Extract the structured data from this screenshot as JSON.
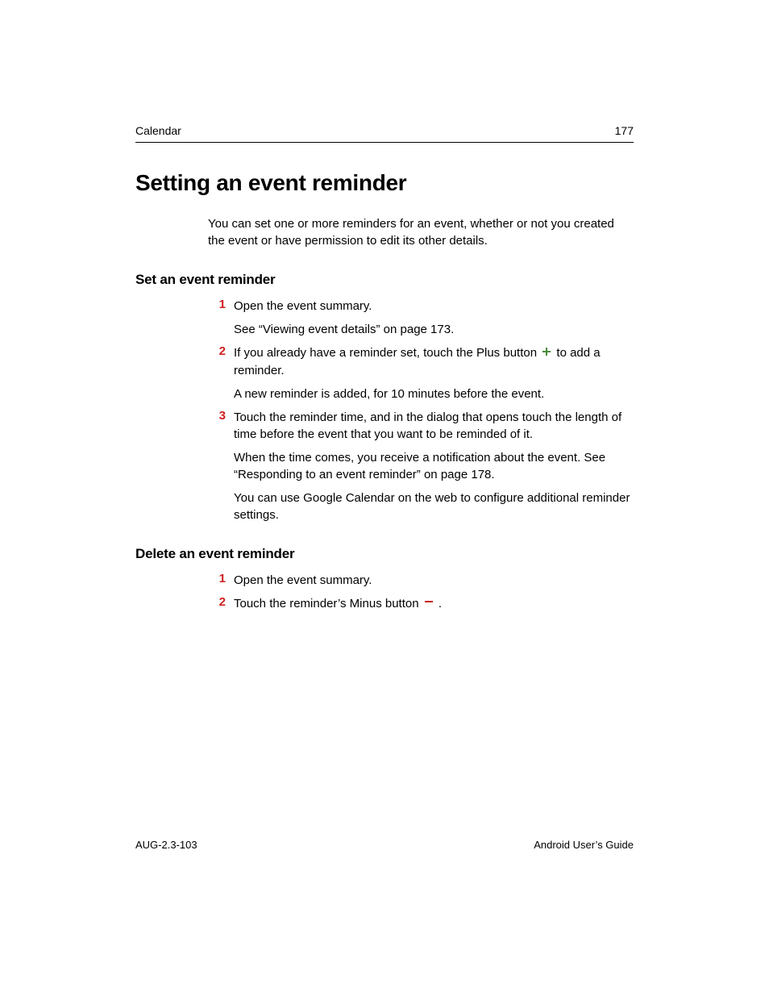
{
  "header": {
    "section": "Calendar",
    "page_number": "177"
  },
  "title": "Setting an event reminder",
  "intro": "You can set one or more reminders for an event, whether or not you created the event or have permission to edit its other details.",
  "sections": [
    {
      "heading": "Set an event reminder",
      "steps": [
        {
          "num": "1",
          "paras": [
            "Open the event summary.",
            "See “Viewing event details” on page 173."
          ]
        },
        {
          "num": "2",
          "paras_pre_icon": "If you already have a reminder set, touch the Plus button",
          "paras_post_icon": " to add a reminder.",
          "icon": "plus",
          "paras_after": [
            "A new reminder is added, for 10 minutes before the event."
          ]
        },
        {
          "num": "3",
          "paras": [
            "Touch the reminder time, and in the dialog that opens touch the length of time before the event that you want to be reminded of it.",
            "When the time comes, you receive a notification about the event. See “Responding to an event reminder” on page 178.",
            "You can use Google Calendar on the web to configure additional reminder settings."
          ]
        }
      ]
    },
    {
      "heading": "Delete an event reminder",
      "steps": [
        {
          "num": "1",
          "paras": [
            "Open the event summary."
          ]
        },
        {
          "num": "2",
          "paras_pre_icon": "Touch the reminder’s Minus button",
          "paras_post_icon": " .",
          "icon": "minus"
        }
      ]
    }
  ],
  "footer": {
    "left": "AUG-2.3-103",
    "right": "Android User’s Guide"
  },
  "icon_color": "#4a8a3a"
}
